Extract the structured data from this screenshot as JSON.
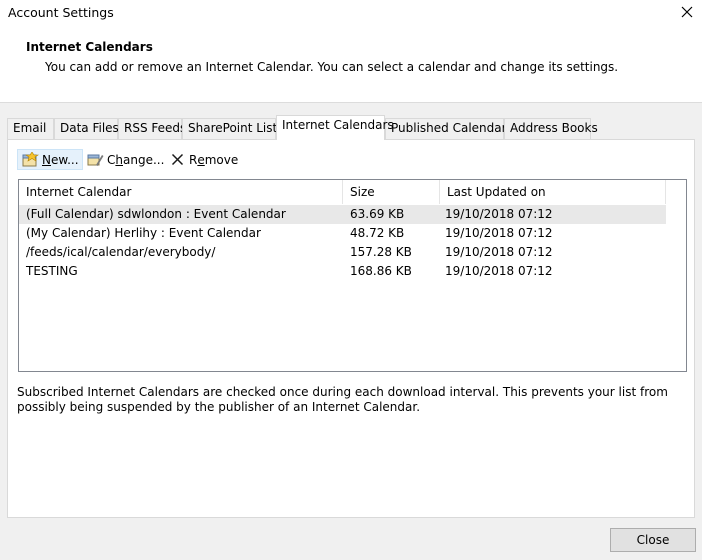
{
  "window": {
    "title": "Account Settings",
    "close_glyph": "✕"
  },
  "header": {
    "title": "Internet Calendars",
    "description": "You can add or remove an Internet Calendar. You can select a calendar and change its settings."
  },
  "tabs": [
    {
      "label": "Email"
    },
    {
      "label": "Data Files"
    },
    {
      "label": "RSS Feeds"
    },
    {
      "label": "SharePoint Lists"
    },
    {
      "label": "Internet Calendars"
    },
    {
      "label": "Published Calendars"
    },
    {
      "label": "Address Books"
    }
  ],
  "active_tab": "Internet Calendars",
  "toolbar": {
    "new": {
      "key": "N",
      "rest": "ew..."
    },
    "change": {
      "pre": "C",
      "key": "h",
      "rest": "ange..."
    },
    "remove": {
      "pre": "R",
      "key": "e",
      "rest": "move"
    }
  },
  "table": {
    "columns": [
      "Internet Calendar",
      "Size",
      "Last Updated on"
    ],
    "rows": [
      {
        "name": "(Full Calendar) sdwlondon : Event Calendar",
        "size": "63.69 KB",
        "updated": "19/10/2018 07:12",
        "selected": true
      },
      {
        "name": "(My Calendar) Herlihy : Event Calendar",
        "size": "48.72 KB",
        "updated": "19/10/2018 07:12",
        "selected": false
      },
      {
        "name": "/feeds/ical/calendar/everybody/",
        "size": "157.28 KB",
        "updated": "19/10/2018 07:12",
        "selected": false
      },
      {
        "name": "TESTING",
        "size": "168.86 KB",
        "updated": "19/10/2018 07:12",
        "selected": false
      }
    ]
  },
  "note": "Subscribed Internet Calendars are checked once during each download interval. This prevents your list from possibly being suspended by the publisher of an Internet Calendar.",
  "footer": {
    "close_label": "Close"
  },
  "colors": {
    "selected_row": "#e8e8e8",
    "hover_button": "#e5f1fb",
    "panel_border": "#d9d9d9"
  },
  "icons": {
    "new": "new-calendar-icon",
    "change": "change-settings-icon",
    "remove": "remove-x-icon"
  }
}
